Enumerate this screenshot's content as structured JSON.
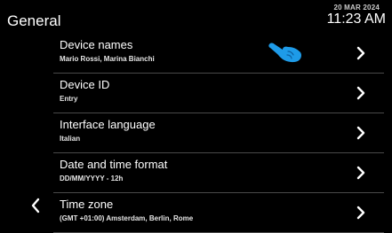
{
  "header": {
    "title": "General",
    "date": "20 MAR 2024",
    "time": "11:23 AM"
  },
  "settings": [
    {
      "title": "Device names",
      "value": "Mario Rossi, Marina Bianchi"
    },
    {
      "title": "Device ID",
      "value": "Entry"
    },
    {
      "title": "Interface language",
      "value": "Italian"
    },
    {
      "title": "Date and time format",
      "value": "DD/MM/YYYY - 12h"
    },
    {
      "title": "Time zone",
      "value": "(GMT +01:00) Amsterdam, Berlin, Rome"
    }
  ],
  "icons": {
    "row_arrow": "chevron-right-icon",
    "back": "chevron-left-icon",
    "pointer": "hand-pointer-icon"
  },
  "colors": {
    "background": "#000000",
    "text": "#ffffff",
    "divider": "#4a4a4a",
    "pointer": "#1e9be8"
  }
}
